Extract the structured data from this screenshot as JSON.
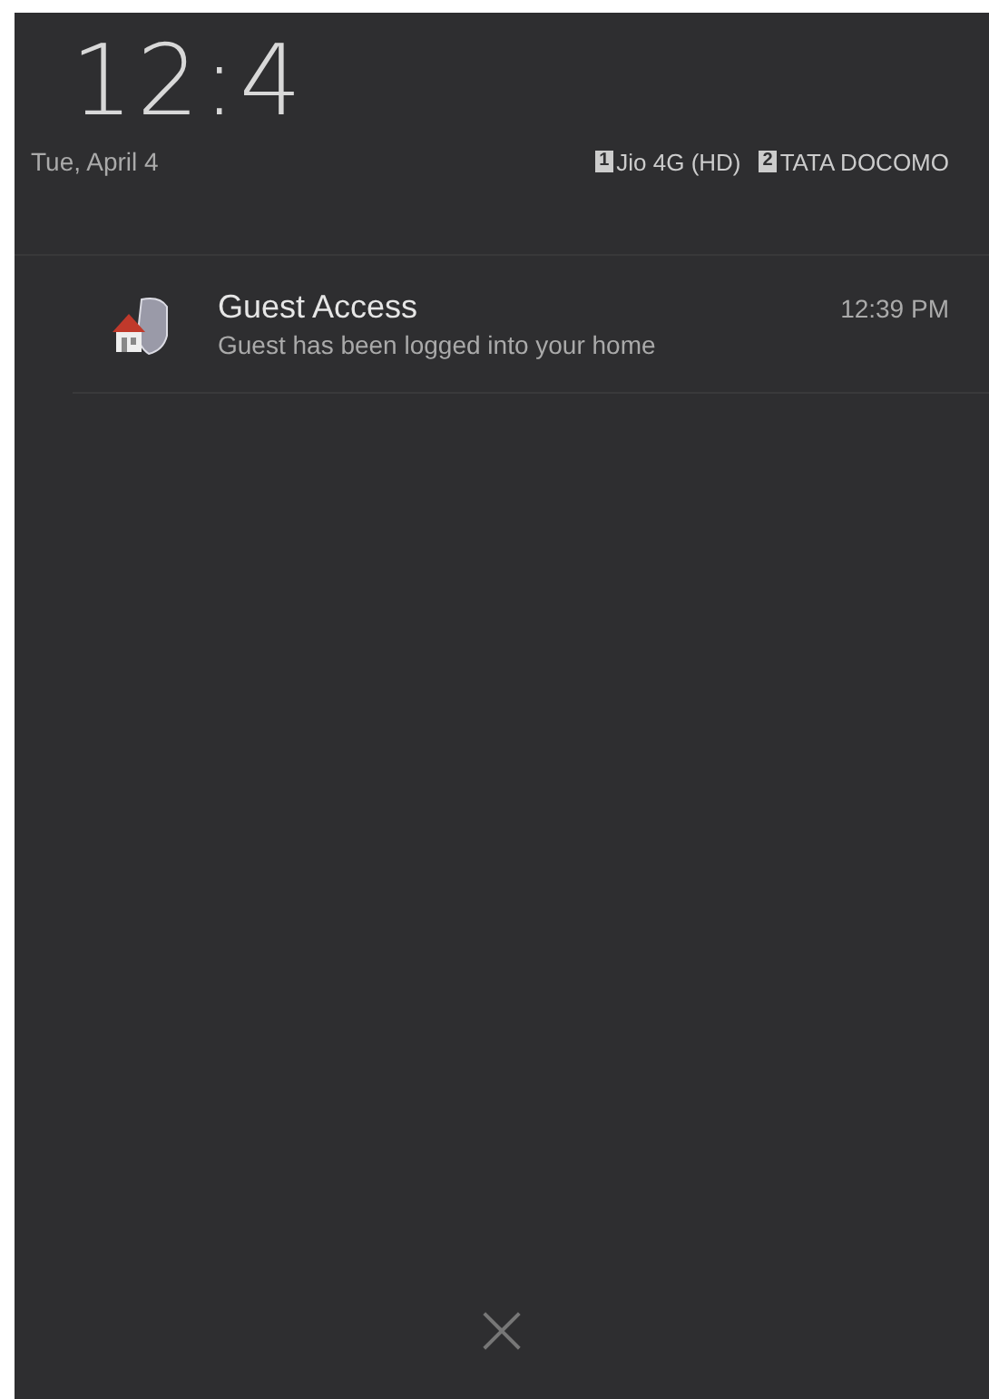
{
  "clock": "12:4",
  "date": "Tue, April 4",
  "sims": [
    {
      "slot": "1",
      "carrier": "Jio 4G (HD)"
    },
    {
      "slot": "2",
      "carrier": "TATA DOCOMO"
    }
  ],
  "notifications": [
    {
      "title": "Guest Access",
      "time": "12:39 PM",
      "text": "Guest has been logged into your home"
    }
  ],
  "clear_button": "×"
}
